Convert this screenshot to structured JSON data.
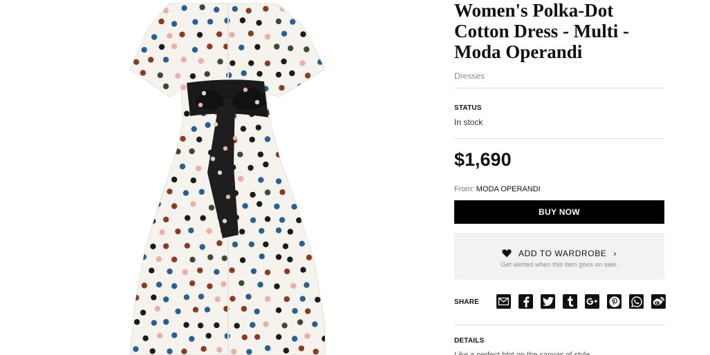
{
  "product": {
    "title": "Women's Polka-Dot Cotton Dress - Multi - Moda Operandi",
    "category": "Dresses",
    "image_alt": "Polka-dot shirt dress with black bow sash"
  },
  "status": {
    "label": "STATUS",
    "value": "In stock"
  },
  "price": "$1,690",
  "retailer": {
    "prefix": "From:",
    "name": "MODA OPERANDI"
  },
  "buy_button": "BUY NOW",
  "wardrobe": {
    "label": "ADD TO WARDROBE",
    "chevron": "›",
    "subtext": "Get alerted when this item goes on sale."
  },
  "share": {
    "label": "SHARE",
    "icons": [
      "email-icon",
      "facebook-icon",
      "twitter-icon",
      "tumblr-icon",
      "google-plus-icon",
      "pinterest-icon",
      "whatsapp-icon",
      "weibo-icon"
    ]
  },
  "details": {
    "label": "DETAILS",
    "text": "Like a perfect blot on the canvas of style..."
  },
  "colors": {
    "accent": "#000000",
    "panel_bg": "#f2f2f2",
    "rule": "#dcdcdc"
  }
}
